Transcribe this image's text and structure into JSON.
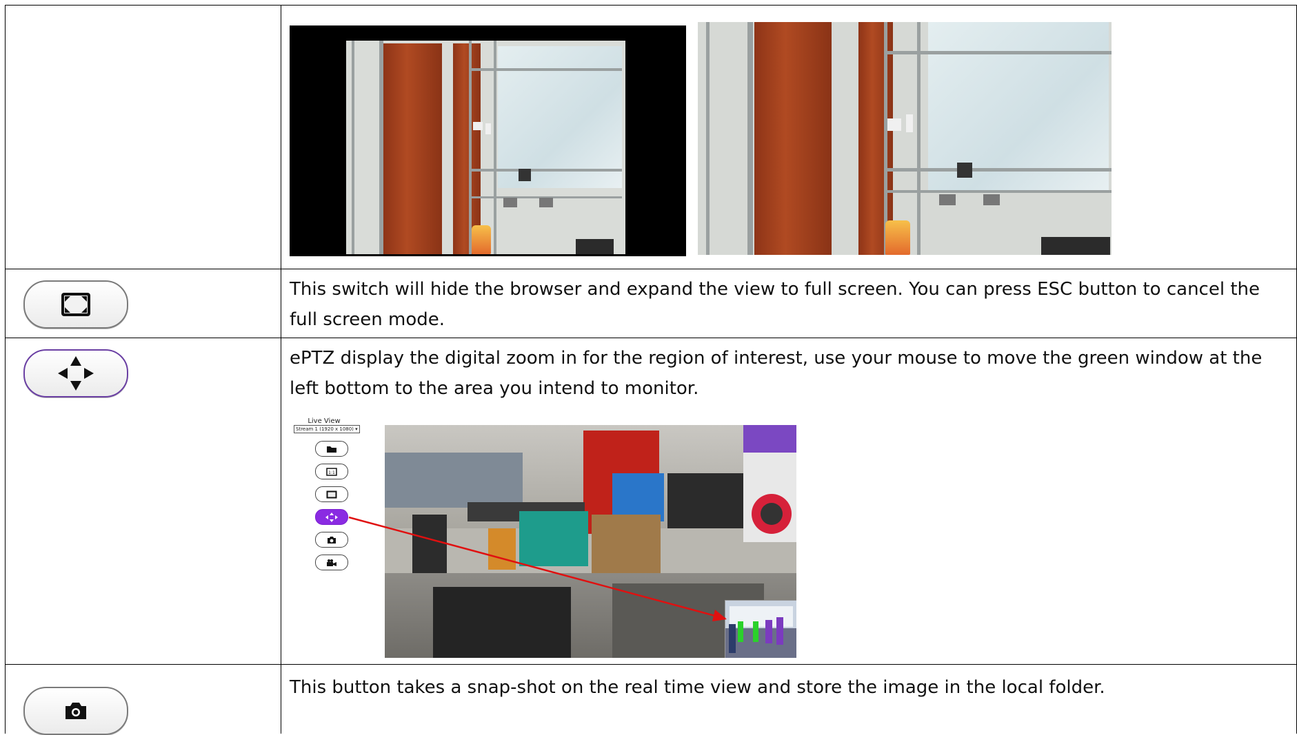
{
  "rows": {
    "fullscreen": {
      "icon": "fullscreen-icon",
      "description": "This switch will hide the browser and expand the view to full screen. You can press ESC button to cancel the full screen mode."
    },
    "eptz": {
      "icon": "eptz-arrows-icon",
      "description": "ePTZ display the digital zoom in for the region of interest, use your mouse to move the green window at the left bottom to the area you intend to monitor.",
      "live_view": {
        "title": "Live View",
        "stream_select": "Stream 1 (1920 x 1080)",
        "buttons": [
          "folder-icon",
          "ratio-1-1-icon",
          "fullscreen-icon",
          "eptz-arrows-icon",
          "camera-icon",
          "video-camera-icon"
        ],
        "active_button": "eptz-arrows-icon"
      }
    },
    "snapshot": {
      "icon": "camera-icon",
      "description": "This button takes a snap-shot on the real time view and store the image in the local folder."
    }
  },
  "colors": {
    "accent_purple": "#8a2be2",
    "arrow_red": "#e01010",
    "table_border": "#000000"
  }
}
